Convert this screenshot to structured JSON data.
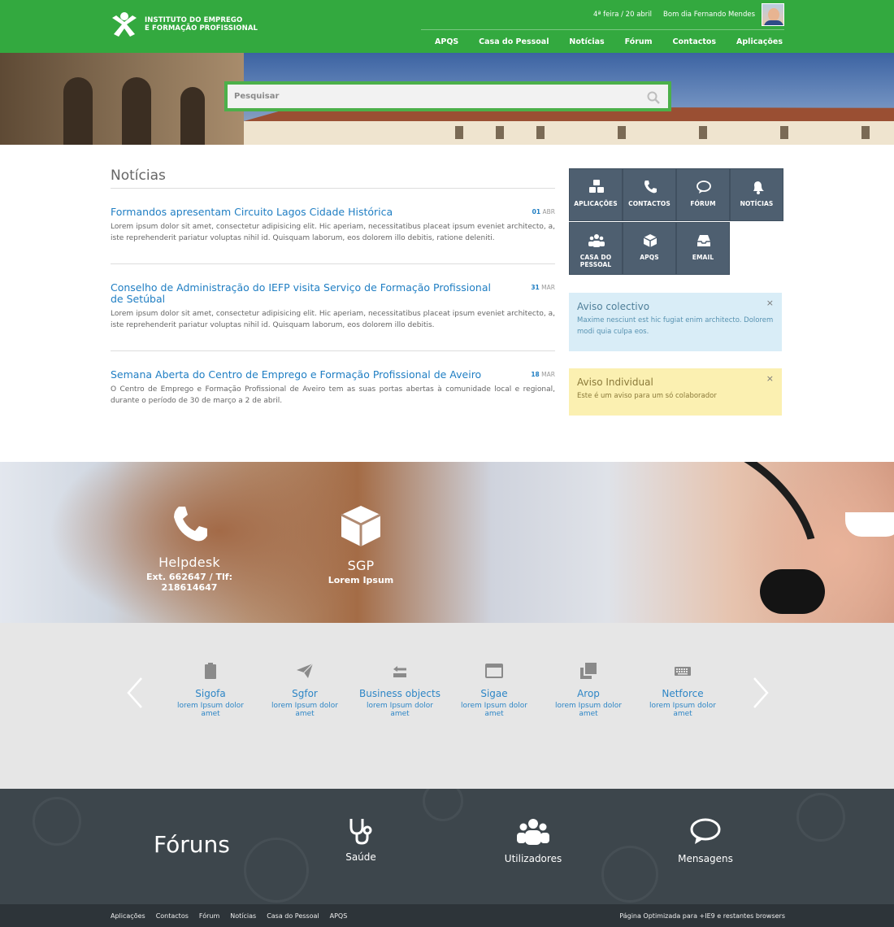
{
  "header": {
    "logo_line1": "INSTITUTO DO EMPREGO",
    "logo_line2": "E FORMAÇÃO PROFISSIONAL",
    "date": "4ª feira / 20 abril",
    "greeting": "Bom dia Fernando Mendes",
    "brand_color": "#33a93f"
  },
  "nav": [
    "APQS",
    "Casa do Pessoal",
    "Notícias",
    "Fórum",
    "Contactos",
    "Aplicações"
  ],
  "search": {
    "placeholder": "Pesquisar"
  },
  "news": {
    "title": "Notícias",
    "items": [
      {
        "title": "Formandos apresentam Circuito Lagos Cidade Histórica",
        "day": "01",
        "month": "ABR",
        "body": "Lorem ipsum dolor sit amet, consectetur adipisicing elit. Hic aperiam, necessitatibus placeat ipsum eveniet architecto, a, iste reprehenderit pariatur voluptas nihil id. Quisquam laborum, eos dolorem illo debitis, ratione deleniti."
      },
      {
        "title": "Conselho de Administração do IEFP visita Serviço de Formação Profissional de Setúbal",
        "day": "31",
        "month": "MAR",
        "body": "Lorem ipsum dolor sit amet, consectetur adipisicing elit. Hic aperiam, necessitatibus placeat ipsum eveniet architecto, a, iste reprehenderit pariatur voluptas nihil id. Quisquam laborum, eos dolorem illo debitis."
      },
      {
        "title": "Semana Aberta do Centro de Emprego e Formação Profissional de Aveiro",
        "day": "18",
        "month": "MAR",
        "body": "O Centro de Emprego e Formação Profissional de Aveiro tem as suas portas abertas à comunidade local e regional, durante o período de 30 de março a 2 de abril."
      }
    ]
  },
  "tiles": [
    {
      "label": "APLICAÇÕES",
      "icon": "cubes-icon"
    },
    {
      "label": "CONTACTOS",
      "icon": "phone-icon"
    },
    {
      "label": "FÓRUM",
      "icon": "chat-icon"
    },
    {
      "label": "NOTÍCIAS",
      "icon": "bell-icon"
    },
    {
      "label": "CASA DO PESSOAL",
      "icon": "users-icon"
    },
    {
      "label": "APQS",
      "icon": "cube-icon"
    },
    {
      "label": "EMAIL",
      "icon": "inbox-icon"
    }
  ],
  "notices": {
    "collective": {
      "title": "Aviso colectivo",
      "body": "Maxime nesciunt est hic fugiat enim architecto. Dolorem modi quia culpa eos.",
      "close": "×"
    },
    "individual": {
      "title": "Aviso Individual",
      "body": "Este é um aviso para um só colaborador",
      "close": "×"
    }
  },
  "helpdesk": {
    "title": "Helpdesk",
    "subtitle": "Ext. 662647 / Tlf: 218614647",
    "sgp_title": "SGP",
    "sgp_subtitle": "Lorem Ipsum"
  },
  "apps": [
    {
      "name": "Sigofa",
      "desc": "lorem Ipsum dolor amet",
      "icon": "clipboard-icon"
    },
    {
      "name": "Sgfor",
      "desc": "lorem Ipsum dolor amet",
      "icon": "paper-plane-icon"
    },
    {
      "name": "Business objects",
      "desc": "lorem Ipsum dolor amet",
      "icon": "exchange-icon"
    },
    {
      "name": "Sigae",
      "desc": "lorem Ipsum dolor amet",
      "icon": "window-icon"
    },
    {
      "name": "Arop",
      "desc": "lorem Ipsum dolor amet",
      "icon": "copy-icon"
    },
    {
      "name": "Netforce",
      "desc": "lorem Ipsum dolor amet",
      "icon": "keyboard-icon"
    }
  ],
  "forums": {
    "title": "Fóruns",
    "items": [
      {
        "label": "Saúde",
        "icon": "stethoscope-icon"
      },
      {
        "label": "Utilizadores",
        "icon": "users-icon"
      },
      {
        "label": "Mensagens",
        "icon": "chat-icon"
      }
    ]
  },
  "footer": {
    "links": [
      "Aplicações",
      "Contactos",
      "Fórum",
      "Notícias",
      "Casa do Pessoal",
      "APQS"
    ],
    "note": "Página Optimizada para +IE9 e restantes browsers"
  }
}
